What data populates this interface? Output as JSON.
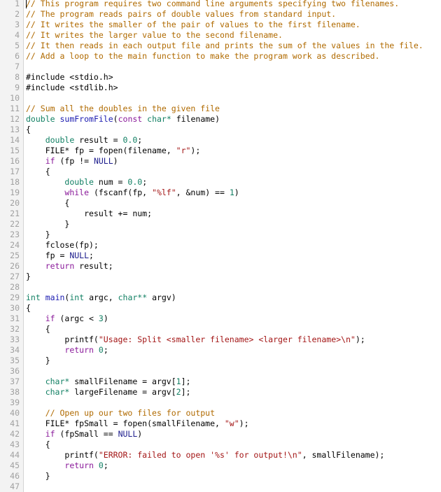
{
  "editor": {
    "cursor_line": 1,
    "colors": {
      "comment": "#b06a00",
      "keyword": "#8a1a9a",
      "type": "#128064",
      "number": "#128064",
      "string": "#a31515",
      "function_name": "#1a1ab0",
      "null_constant": "#1c1c8c",
      "line_number": "#a0a0a0",
      "gutter_bg": "#f3f3f3"
    },
    "lines": [
      [
        [
          "cm",
          "// This program requires two command line arguments specifying two filenames."
        ]
      ],
      [
        [
          "cm",
          "// The program reads pairs of double values from standard input."
        ]
      ],
      [
        [
          "cm",
          "// It writes the smaller of the pair of values to the first filename."
        ]
      ],
      [
        [
          "cm",
          "// It writes the larger value to the second filename."
        ]
      ],
      [
        [
          "cm",
          "// It then reads in each output file and prints the sum of the values in the file."
        ]
      ],
      [
        [
          "cm",
          "// Add a loop to the main function to make the program work as described."
        ]
      ],
      [],
      [
        [
          "pp",
          "#include <stdio.h>"
        ]
      ],
      [
        [
          "pp",
          "#include <stdlib.h>"
        ]
      ],
      [],
      [
        [
          "cm",
          "// Sum all the doubles in the given file"
        ]
      ],
      [
        [
          "ty",
          "double"
        ],
        [
          "p",
          " "
        ],
        [
          "fn",
          "sumFromFile"
        ],
        [
          "p",
          "("
        ],
        [
          "kw",
          "const"
        ],
        [
          "p",
          " "
        ],
        [
          "ty",
          "char*"
        ],
        [
          "p",
          " filename)"
        ]
      ],
      [
        [
          "p",
          "{"
        ]
      ],
      [
        [
          "p",
          "    "
        ],
        [
          "ty",
          "double"
        ],
        [
          "p",
          " result = "
        ],
        [
          "num",
          "0.0"
        ],
        [
          "p",
          ";"
        ]
      ],
      [
        [
          "p",
          "    FILE* fp = fopen(filename, "
        ],
        [
          "str",
          "\"r\""
        ],
        [
          "p",
          ");"
        ]
      ],
      [
        [
          "p",
          "    "
        ],
        [
          "kw",
          "if"
        ],
        [
          "p",
          " (fp != "
        ],
        [
          "nl",
          "NULL"
        ],
        [
          "p",
          ")"
        ]
      ],
      [
        [
          "p",
          "    {"
        ]
      ],
      [
        [
          "p",
          "        "
        ],
        [
          "ty",
          "double"
        ],
        [
          "p",
          " num = "
        ],
        [
          "num",
          "0.0"
        ],
        [
          "p",
          ";"
        ]
      ],
      [
        [
          "p",
          "        "
        ],
        [
          "kw",
          "while"
        ],
        [
          "p",
          " (fscanf(fp, "
        ],
        [
          "str",
          "\"%lf\""
        ],
        [
          "p",
          ", &num) == "
        ],
        [
          "num",
          "1"
        ],
        [
          "p",
          ")"
        ]
      ],
      [
        [
          "p",
          "        {"
        ]
      ],
      [
        [
          "p",
          "            result += num;"
        ]
      ],
      [
        [
          "p",
          "        }"
        ]
      ],
      [
        [
          "p",
          "    }"
        ]
      ],
      [
        [
          "p",
          "    fclose(fp);"
        ]
      ],
      [
        [
          "p",
          "    fp = "
        ],
        [
          "nl",
          "NULL"
        ],
        [
          "p",
          ";"
        ]
      ],
      [
        [
          "p",
          "    "
        ],
        [
          "kw",
          "return"
        ],
        [
          "p",
          " result;"
        ]
      ],
      [
        [
          "p",
          "}"
        ]
      ],
      [],
      [
        [
          "ty",
          "int"
        ],
        [
          "p",
          " "
        ],
        [
          "fn",
          "main"
        ],
        [
          "p",
          "("
        ],
        [
          "ty",
          "int"
        ],
        [
          "p",
          " argc, "
        ],
        [
          "ty",
          "char**"
        ],
        [
          "p",
          " argv)"
        ]
      ],
      [
        [
          "p",
          "{"
        ]
      ],
      [
        [
          "p",
          "    "
        ],
        [
          "kw",
          "if"
        ],
        [
          "p",
          " (argc < "
        ],
        [
          "num",
          "3"
        ],
        [
          "p",
          ")"
        ]
      ],
      [
        [
          "p",
          "    {"
        ]
      ],
      [
        [
          "p",
          "        printf("
        ],
        [
          "str",
          "\"Usage: Split <smaller filename> <larger filename>\\n\""
        ],
        [
          "p",
          ");"
        ]
      ],
      [
        [
          "p",
          "        "
        ],
        [
          "kw",
          "return"
        ],
        [
          "p",
          " "
        ],
        [
          "num",
          "0"
        ],
        [
          "p",
          ";"
        ]
      ],
      [
        [
          "p",
          "    }"
        ]
      ],
      [],
      [
        [
          "p",
          "    "
        ],
        [
          "ty",
          "char*"
        ],
        [
          "p",
          " smallFilename = argv["
        ],
        [
          "num",
          "1"
        ],
        [
          "p",
          "];"
        ]
      ],
      [
        [
          "p",
          "    "
        ],
        [
          "ty",
          "char*"
        ],
        [
          "p",
          " largeFilename = argv["
        ],
        [
          "num",
          "2"
        ],
        [
          "p",
          "];"
        ]
      ],
      [],
      [
        [
          "p",
          "    "
        ],
        [
          "cm",
          "// Open up our two files for output"
        ]
      ],
      [
        [
          "p",
          "    FILE* fpSmall = fopen(smallFilename, "
        ],
        [
          "str",
          "\"w\""
        ],
        [
          "p",
          ");"
        ]
      ],
      [
        [
          "p",
          "    "
        ],
        [
          "kw",
          "if"
        ],
        [
          "p",
          " (fpSmall == "
        ],
        [
          "nl",
          "NULL"
        ],
        [
          "p",
          ")"
        ]
      ],
      [
        [
          "p",
          "    {"
        ]
      ],
      [
        [
          "p",
          "        printf("
        ],
        [
          "str",
          "\"ERROR: failed to open '%s' for output!\\n\""
        ],
        [
          "p",
          ", smallFilename);"
        ]
      ],
      [
        [
          "p",
          "        "
        ],
        [
          "kw",
          "return"
        ],
        [
          "p",
          " "
        ],
        [
          "num",
          "0"
        ],
        [
          "p",
          ";"
        ]
      ],
      [
        [
          "p",
          "    }"
        ]
      ],
      []
    ]
  }
}
